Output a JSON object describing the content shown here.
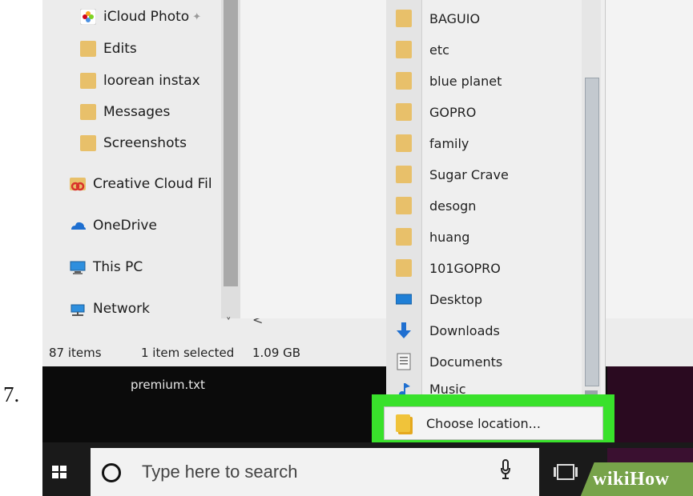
{
  "step": {
    "number": "7."
  },
  "nav_pane": {
    "items": [
      {
        "label": "iCloud Photo",
        "icon": "photos-icon",
        "pinned": true
      },
      {
        "label": "Edits",
        "icon": "folder-icon"
      },
      {
        "label": "loorean instax",
        "icon": "folder-icon"
      },
      {
        "label": "Messages",
        "icon": "folder-icon"
      },
      {
        "label": "Screenshots",
        "icon": "folder-icon"
      },
      {
        "label": "Creative Cloud Fil",
        "icon": "creative-cloud-icon"
      },
      {
        "label": "OneDrive",
        "icon": "onedrive-cloud-icon"
      },
      {
        "label": "This PC",
        "icon": "computer-icon"
      },
      {
        "label": "Network",
        "icon": "network-icon"
      }
    ]
  },
  "status_bar": {
    "item_count": "87 items",
    "selection": "1 item selected",
    "size": "1.09 GB"
  },
  "desktop": {
    "file_label": "premium.txt"
  },
  "location_menu": {
    "items": [
      {
        "label": "BAGUIO",
        "icon": "folder-icon"
      },
      {
        "label": "etc",
        "icon": "folder-icon"
      },
      {
        "label": "blue planet",
        "icon": "folder-icon"
      },
      {
        "label": "GOPRO",
        "icon": "folder-icon"
      },
      {
        "label": "family",
        "icon": "folder-icon"
      },
      {
        "label": "Sugar Crave",
        "icon": "folder-icon"
      },
      {
        "label": "desogn",
        "icon": "folder-icon"
      },
      {
        "label": "huang",
        "icon": "folder-icon"
      },
      {
        "label": "101GOPRO",
        "icon": "folder-icon"
      },
      {
        "label": "Desktop",
        "icon": "desktop-icon"
      },
      {
        "label": "Downloads",
        "icon": "download-arrow-icon"
      },
      {
        "label": "Documents",
        "icon": "document-icon"
      },
      {
        "label": "Music",
        "icon": "music-note-icon"
      }
    ],
    "choose_location": "Choose location..."
  },
  "taskbar": {
    "search_placeholder": "Type here to search"
  },
  "watermark": {
    "brand": "wikiHow"
  },
  "colors": {
    "highlight": "#39e12b",
    "folder": "#e8c06a",
    "taskbar": "#1a1a1a",
    "explorer_bg": "#ececec"
  }
}
